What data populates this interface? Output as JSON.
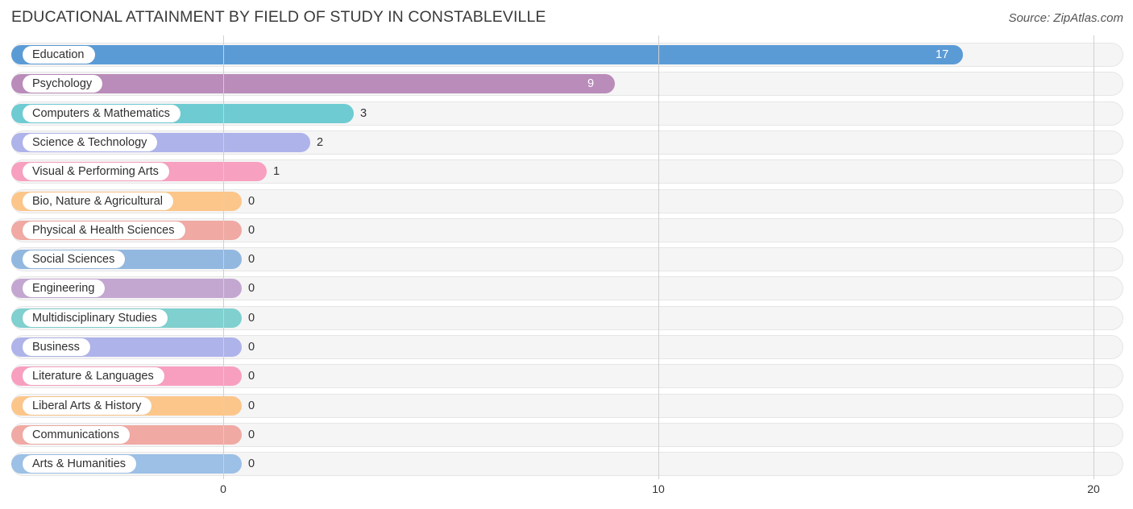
{
  "header": {
    "title": "EDUCATIONAL ATTAINMENT BY FIELD OF STUDY IN CONSTABLEVILLE",
    "source": "Source: ZipAtlas.com"
  },
  "chart_data": {
    "type": "bar",
    "orientation": "horizontal",
    "title": "EDUCATIONAL ATTAINMENT BY FIELD OF STUDY IN CONSTABLEVILLE",
    "xlabel": "",
    "ylabel": "",
    "xlim": [
      0,
      20
    ],
    "grid": true,
    "legend": null,
    "xticks": [
      "0",
      "10",
      "20"
    ],
    "xtick_values": [
      0,
      10,
      20
    ],
    "categories": [
      "Education",
      "Psychology",
      "Computers & Mathematics",
      "Science & Technology",
      "Visual & Performing Arts",
      "Bio, Nature & Agricultural",
      "Physical & Health Sciences",
      "Social Sciences",
      "Engineering",
      "Multidisciplinary Studies",
      "Business",
      "Literature & Languages",
      "Liberal Arts & History",
      "Communications",
      "Arts & Humanities"
    ],
    "values": [
      17,
      9,
      3,
      2,
      1,
      0,
      0,
      0,
      0,
      0,
      0,
      0,
      0,
      0,
      0
    ],
    "value_labels": [
      "17",
      "9",
      "3",
      "2",
      "1",
      "0",
      "0",
      "0",
      "0",
      "0",
      "0",
      "0",
      "0",
      "0",
      "0"
    ],
    "colors": [
      "#5b9bd5",
      "#b98cba",
      "#6ecbd2",
      "#aeb3ea",
      "#f7a0bf",
      "#fcc68b",
      "#f0a9a3",
      "#92b8e0",
      "#c4a7d1",
      "#7fd0cf",
      "#aeb3ea",
      "#f89fc0",
      "#fcc68b",
      "#f0a9a3",
      "#9cc0e6"
    ],
    "track_color": "#f5f5f5",
    "grid_color": "#d0d0d0",
    "label_text_color": "#2f2f2f"
  }
}
